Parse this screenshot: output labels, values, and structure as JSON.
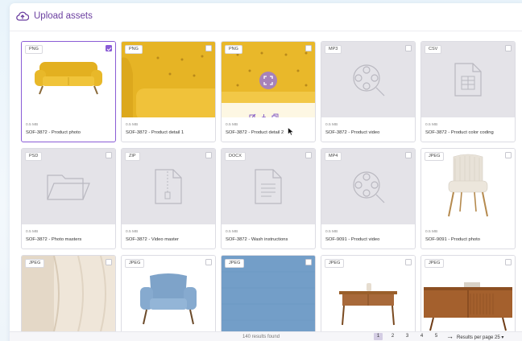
{
  "header": {
    "upload_label": "Upload assets"
  },
  "cards": [
    {
      "tag": "PNG",
      "size": "0.5 MB",
      "name": "SOF-3872 - Product photo",
      "checked": true
    },
    {
      "tag": "PNG",
      "size": "0.5 MB",
      "name": "SOF-3872 - Product detail 1",
      "checked": false
    },
    {
      "tag": "PNG",
      "size": "0.5 MB",
      "name": "SOF-3872 - Product detail 2",
      "checked": false
    },
    {
      "tag": "MP3",
      "size": "0.5 MB",
      "name": "SOF-3872 - Product video",
      "checked": false
    },
    {
      "tag": "CSV",
      "size": "0.5 MB",
      "name": "SOF-3872 - Product color coding",
      "checked": false
    },
    {
      "tag": "PSD",
      "size": "0.5 MB",
      "name": "SOF-3872 - Photo masters",
      "checked": false
    },
    {
      "tag": "ZIP",
      "size": "0.5 MB",
      "name": "SOF-3872 - Video master",
      "checked": false
    },
    {
      "tag": "DOCX",
      "size": "0.5 MB",
      "name": "SOF-3872 - Wash instructions",
      "checked": false
    },
    {
      "tag": "MP4",
      "size": "0.5 MB",
      "name": "SOF-9091 - Product video",
      "checked": false
    },
    {
      "tag": "JPEG",
      "size": "0.5 MB",
      "name": "SOF-9091 - Product photo",
      "checked": false
    },
    {
      "tag": "JPEG"
    },
    {
      "tag": "JPEG"
    },
    {
      "tag": "JPEG"
    },
    {
      "tag": "JPEG"
    },
    {
      "tag": "JPEG"
    }
  ],
  "footer": {
    "results_found": "140 results found",
    "pages": [
      "1",
      "2",
      "3",
      "4",
      "5"
    ],
    "current_page": "1",
    "next_arrow": "→",
    "results_per_page_label": "Results per page",
    "results_per_page_value": "25 ▾"
  },
  "colors": {
    "accent": "#6b3fa0",
    "selected_border": "#8a5cd6",
    "mustard": "#e8b829"
  },
  "icons": [
    "upload-cloud-icon",
    "film-reel-icon",
    "spreadsheet-file-icon",
    "folder-icon",
    "zip-file-icon",
    "document-file-icon",
    "expand-icon",
    "edit-icon",
    "download-icon",
    "copy-icon",
    "arrow-right-icon"
  ]
}
